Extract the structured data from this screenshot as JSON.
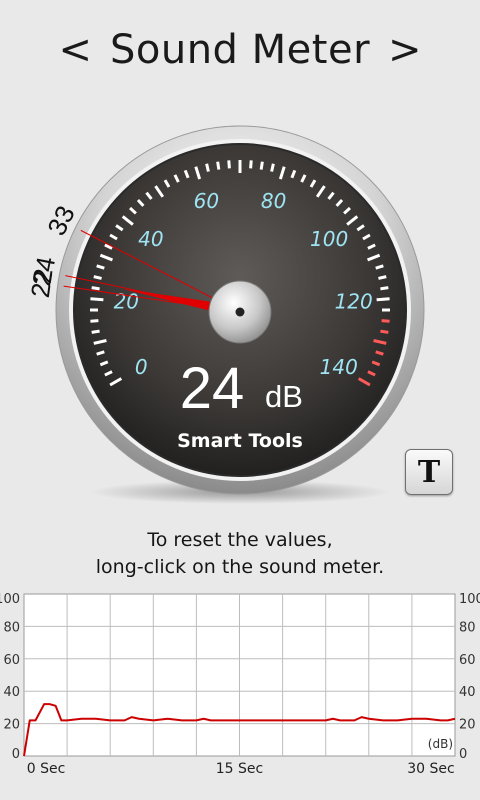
{
  "header": {
    "prev_label": "<",
    "title": "Sound Meter",
    "next_label": ">"
  },
  "gauge": {
    "scale_labels": [
      "0",
      "20",
      "40",
      "60",
      "80",
      "100",
      "120",
      "140"
    ],
    "reading_value": "24",
    "reading_unit": "dB",
    "brand": "Smart Tools",
    "min_value": 0,
    "max_value": 140,
    "current_value": 24,
    "peak_marks": [
      {
        "label": "33",
        "value": 33
      },
      {
        "label": "24",
        "value": 24
      },
      {
        "label": "22",
        "value": 22
      }
    ],
    "colors": {
      "scale_numbers": "#9fe4f2",
      "danger_ticks": "#ff5a5a",
      "needle": "#e00000"
    }
  },
  "toolbar": {
    "t_button_label": "T"
  },
  "instructions": {
    "line1": "To reset the values,",
    "line2": "long-click on the sound meter."
  },
  "chart_data": {
    "type": "line",
    "title": "",
    "xlabel": "",
    "ylabel": "(dB)",
    "x_tick_labels": [
      "0 Sec",
      "15 Sec",
      "30 Sec"
    ],
    "y_ticks": [
      0,
      20,
      40,
      60,
      80,
      100
    ],
    "xlim": [
      0,
      30
    ],
    "ylim": [
      0,
      100
    ],
    "grid": true,
    "line_color": "#cc0000",
    "series": [
      {
        "x": [
          0,
          0.4,
          0.8,
          1.4,
          1.8,
          2.2,
          2.6,
          3.0,
          4.0,
          5.0,
          6.0,
          7.0,
          7.5,
          8.0,
          9.0,
          10.0,
          11.0,
          12.0,
          12.5,
          13.0,
          14.0,
          15.0,
          16.0,
          17.0,
          18.0,
          19.0,
          20.0,
          21.0,
          21.5,
          22.0,
          23.0,
          23.5,
          24.0,
          25.0,
          26.0,
          27.0,
          28.0,
          29.0,
          29.5,
          30.0
        ],
        "y": [
          0,
          22,
          22,
          32,
          32,
          31,
          22,
          22,
          23,
          23,
          22,
          22,
          24,
          23,
          22,
          23,
          22,
          22,
          23,
          22,
          22,
          22,
          22,
          22,
          22,
          22,
          22,
          22,
          23,
          22,
          22,
          24,
          23,
          22,
          22,
          23,
          23,
          22,
          22,
          23
        ]
      }
    ]
  }
}
